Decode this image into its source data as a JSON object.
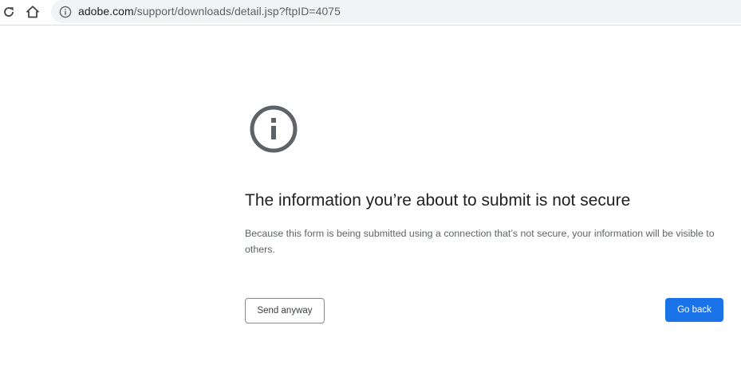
{
  "browser": {
    "url_host": "adobe.com",
    "url_path": "/support/downloads/detail.jsp?ftpID=4075",
    "icons": {
      "reload": "reload-icon",
      "home": "home-icon",
      "site_info": "info-icon"
    }
  },
  "interstitial": {
    "icon": "info-icon",
    "heading": "The information you’re about to submit is not secure",
    "explanation": "Because this form is being submitted using a connection that’s not secure, your information will be visible to others.",
    "send_anyway_label": "Send anyway",
    "go_back_label": "Go back",
    "colors": {
      "primary_button": "#1a73e8",
      "heading_text": "#202124",
      "body_text": "#5f6368"
    }
  }
}
